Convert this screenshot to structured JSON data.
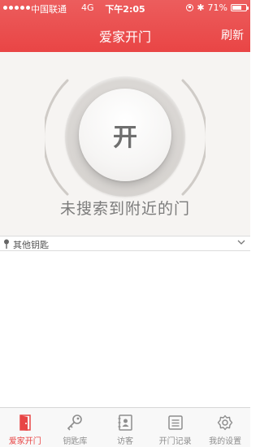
{
  "status_bar": {
    "carrier": "中国联通",
    "network": "4G",
    "time": "下午2:05",
    "battery": "71%",
    "battery_level": 0.71
  },
  "nav": {
    "title": "爱家开门",
    "refresh_label": "刷新"
  },
  "hero": {
    "open_label": "开",
    "search_status": "未搜索到附近的门"
  },
  "keys": {
    "label": "其他钥匙"
  },
  "tabs": [
    {
      "label": "爱家开门",
      "icon": "door-icon",
      "active": true
    },
    {
      "label": "钥匙库",
      "icon": "key-icon",
      "active": false
    },
    {
      "label": "访客",
      "icon": "contacts-icon",
      "active": false
    },
    {
      "label": "开门记录",
      "icon": "records-icon",
      "active": false
    },
    {
      "label": "我的设置",
      "icon": "settings-icon",
      "active": false
    }
  ],
  "colors": {
    "brand": "#e94545",
    "hero_bg": "#f6f4f2",
    "tab_inactive": "#8e8e8e"
  }
}
